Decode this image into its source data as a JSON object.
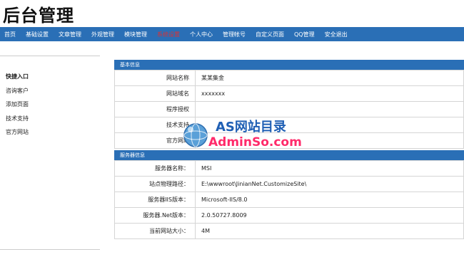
{
  "app_title": "后台管理",
  "nav": {
    "items": [
      {
        "label": "首页"
      },
      {
        "label": "基础设置"
      },
      {
        "label": "文章管理"
      },
      {
        "label": "外观管理"
      },
      {
        "label": "模块管理"
      },
      {
        "label": "系统设置"
      },
      {
        "label": "个人中心"
      },
      {
        "label": "管理帐号"
      },
      {
        "label": "自定义页面"
      },
      {
        "label": "QQ管理"
      },
      {
        "label": "安全退出"
      }
    ],
    "active_index": 5
  },
  "sidebar": {
    "items": [
      {
        "label": "快捷入口"
      },
      {
        "label": "咨询客户"
      },
      {
        "label": "添加页面"
      },
      {
        "label": "技术支持"
      },
      {
        "label": "官方网站"
      }
    ]
  },
  "basic_info": {
    "title": "基本信息",
    "rows": [
      {
        "key": "网站名称",
        "value": "某某集金"
      },
      {
        "key": "网站域名",
        "value": "xxxxxxx"
      },
      {
        "key": "程序授权",
        "value": ""
      },
      {
        "key": "技术支持",
        "value": ""
      },
      {
        "key": "官方网站",
        "value": ""
      }
    ]
  },
  "server_info": {
    "title": "服务器信息",
    "rows": [
      {
        "key": "服务器名称：",
        "value": "MSI"
      },
      {
        "key": "站点物理路径：",
        "value": "E:\\wwwroot\\JinianNet.CustomizeSite\\"
      },
      {
        "key": "服务器IIS版本：",
        "value": "Microsoft-IIS/8.0"
      },
      {
        "key": "服务器.Net版本：",
        "value": "2.0.50727.8009"
      },
      {
        "key": "当前网站大小：",
        "value": "4M"
      }
    ]
  },
  "watermark": {
    "line1": "AS网站目录",
    "line2": "AdminSo.com"
  },
  "colors": {
    "nav_bg": "#2a6fb6",
    "nav_active": "#e03030",
    "watermark_blue": "#1f5fb4",
    "watermark_pink": "#ff2a6a"
  }
}
